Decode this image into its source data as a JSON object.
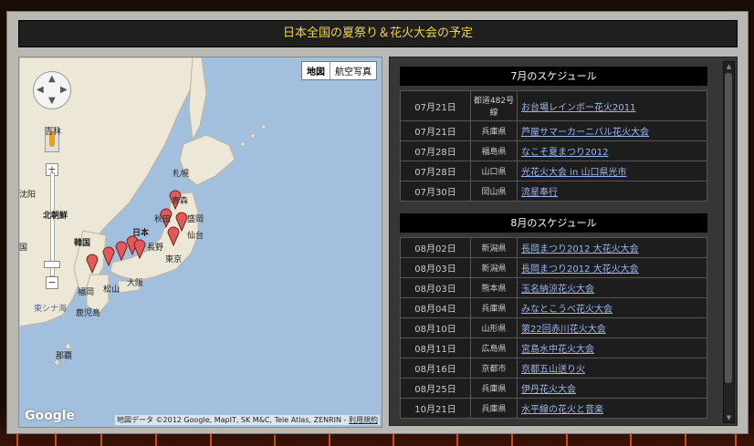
{
  "page_title": "日本全国の夏祭り＆花火大会の予定",
  "map": {
    "type_buttons": [
      "地図",
      "航空写真"
    ],
    "labels": {
      "sapporo": "札幌",
      "aomori": "青森",
      "morioka": "盛岡",
      "sendai": "仙台",
      "akita": "秋田",
      "nihon": "日本",
      "nagano": "長野",
      "tokyo": "東京",
      "osaka": "大阪",
      "matsuyama": "松山",
      "fukuoka": "福岡",
      "kagoshima": "鹿児島",
      "naha": "那覇",
      "kankoku": "韓国",
      "kitachosen": "北朝鮮",
      "shenyang": "沈阳",
      "eastchinasea": "東シナ海",
      "kuni": "国",
      "kirin": "吉林"
    },
    "google_label": "Google",
    "attribution": "地図データ ©2012 Google, MapIT, SK M&C, Tele Atlas, ZENRIN -",
    "terms_link": "利用規約"
  },
  "schedule": {
    "july": {
      "header": "7月のスケジュール",
      "rows": [
        {
          "date": "07月21日",
          "pref": "都道482号線",
          "event": "お台場レインボー花火2011"
        },
        {
          "date": "07月21日",
          "pref": "兵庫県",
          "event": "芦屋サマーカーニバル花火大会"
        },
        {
          "date": "07月28日",
          "pref": "福島県",
          "event": "なこそ夏まつり2012"
        },
        {
          "date": "07月28日",
          "pref": "山口県",
          "event": "光花火大会 in 山口県光市"
        },
        {
          "date": "07月30日",
          "pref": "岡山県",
          "event": "流星奉行"
        }
      ]
    },
    "august": {
      "header": "8月のスケジュール",
      "rows": [
        {
          "date": "08月02日",
          "pref": "新潟県",
          "event": "長岡まつり2012 大花火大会"
        },
        {
          "date": "08月03日",
          "pref": "新潟県",
          "event": "長岡まつり2012 大花火大会"
        },
        {
          "date": "08月03日",
          "pref": "熊本県",
          "event": "玉名納涼花火大会"
        },
        {
          "date": "08月04日",
          "pref": "兵庫県",
          "event": "みなとこうべ花火大会"
        },
        {
          "date": "08月10日",
          "pref": "山形県",
          "event": "第22回赤川花火大会"
        },
        {
          "date": "08月11日",
          "pref": "広島県",
          "event": "宮島水中花火大会"
        },
        {
          "date": "08月16日",
          "pref": "京都市",
          "event": "京都五山送り火"
        },
        {
          "date": "08月25日",
          "pref": "兵庫県",
          "event": "伊丹花火大会"
        },
        {
          "date": "10月21日",
          "pref": "兵庫県",
          "event": "水平線の花火と音楽"
        }
      ]
    }
  },
  "colors": {
    "title_text": "#f0d34a",
    "link": "#9ab7ef",
    "marker": "#e05a5a"
  }
}
